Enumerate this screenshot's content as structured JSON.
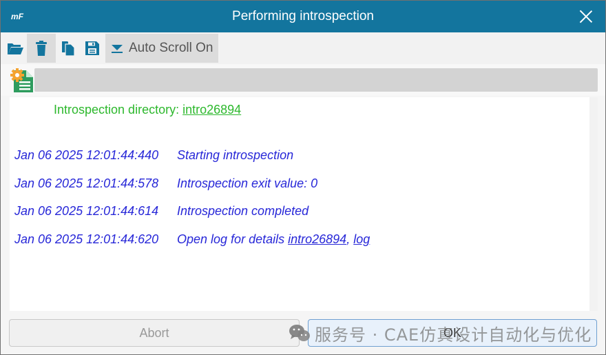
{
  "window": {
    "app_logo": "mF",
    "title": "Performing introspection",
    "close_icon": "close-icon"
  },
  "toolbar": {
    "buttons": [
      {
        "name": "open",
        "icon": "folder-open-icon"
      },
      {
        "name": "clear",
        "icon": "trash-icon"
      },
      {
        "name": "copy",
        "icon": "copy-icon"
      },
      {
        "name": "save",
        "icon": "save-icon"
      }
    ],
    "autoscroll_icon": "scroll-down-icon",
    "autoscroll_label": "Auto Scroll On"
  },
  "status": {
    "icon": "settings-document-icon",
    "progress": 0
  },
  "log": {
    "directory_label": "Introspection directory: ",
    "directory_link": "intro26894",
    "entries": [
      {
        "timestamp": "Jan 06 2025 12:01:44:440",
        "message": "Starting introspection"
      },
      {
        "timestamp": "Jan 06 2025 12:01:44:578",
        "message": "Introspection exit value: 0"
      },
      {
        "timestamp": "Jan 06 2025 12:01:44:614",
        "message": "Introspection completed"
      },
      {
        "timestamp": "Jan 06 2025 12:01:44:620",
        "message": "Open log for details ",
        "link1": "intro26894",
        "separator": ", ",
        "link2": "log"
      }
    ]
  },
  "buttons": {
    "abort": "Abort",
    "ok": "OK"
  },
  "watermark": {
    "icon": "wechat-icon",
    "text": "服务号 · CAE仿真设计自动化与优化"
  },
  "colors": {
    "titlebar": "#13759e",
    "icon_blue": "#13759e",
    "directory_green": "#2db82d",
    "log_blue": "#2727d8"
  }
}
